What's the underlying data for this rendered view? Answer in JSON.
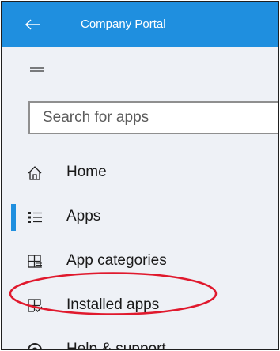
{
  "window": {
    "title": "Company Portal",
    "accent_color": "#1f8fdf",
    "back_icon": "arrow-left-icon"
  },
  "menu": {
    "icon": "hamburger-icon"
  },
  "search": {
    "placeholder": "Search for apps",
    "value": ""
  },
  "nav": {
    "items": [
      {
        "label": "Home",
        "icon": "home-icon",
        "active": false
      },
      {
        "label": "Apps",
        "icon": "apps-list-icon",
        "active": true
      },
      {
        "label": "App categories",
        "icon": "app-categories-icon",
        "active": false
      },
      {
        "label": "Installed apps",
        "icon": "installed-apps-icon",
        "active": false,
        "annotated": true
      },
      {
        "label": "Help & support",
        "icon": "help-support-icon",
        "active": false
      }
    ]
  },
  "annotation": {
    "color": "#e0192d",
    "shape": "ellipse"
  }
}
